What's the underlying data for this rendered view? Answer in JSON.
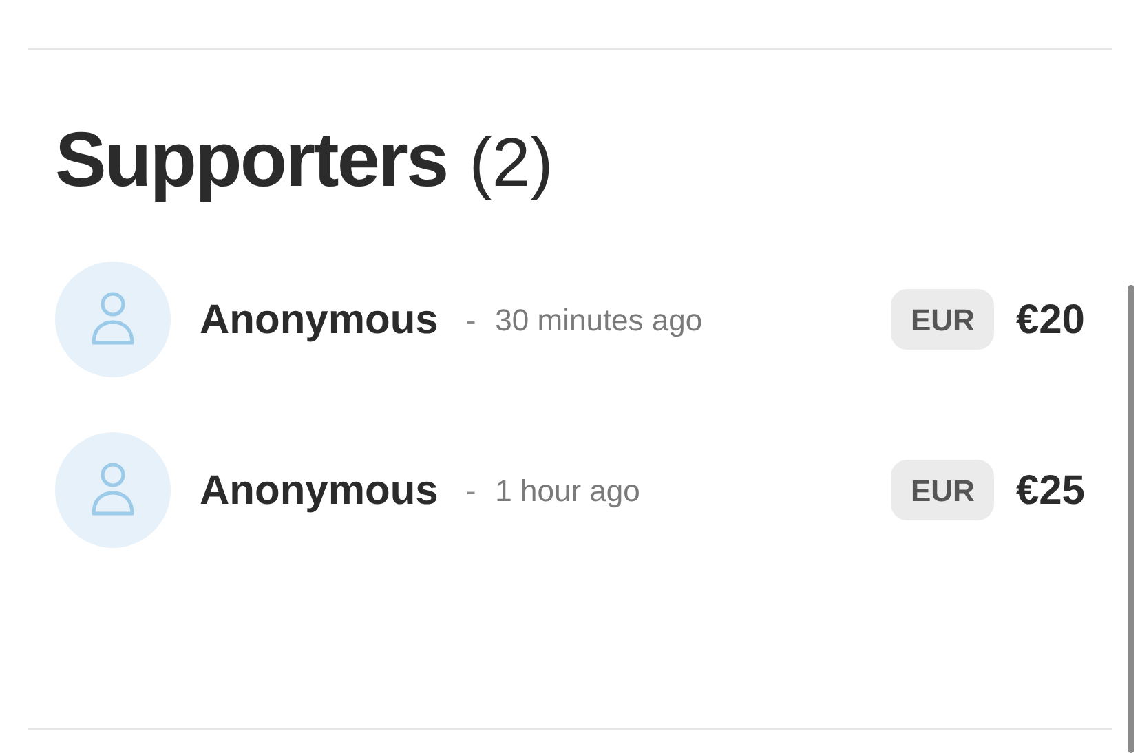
{
  "title": "Supporters",
  "count": "(2)",
  "supporters": [
    {
      "name": "Anonymous",
      "separator": "-",
      "time": "30 minutes ago",
      "currency": "EUR",
      "amount": "€20"
    },
    {
      "name": "Anonymous",
      "separator": "-",
      "time": "1 hour ago",
      "currency": "EUR",
      "amount": "€25"
    }
  ]
}
